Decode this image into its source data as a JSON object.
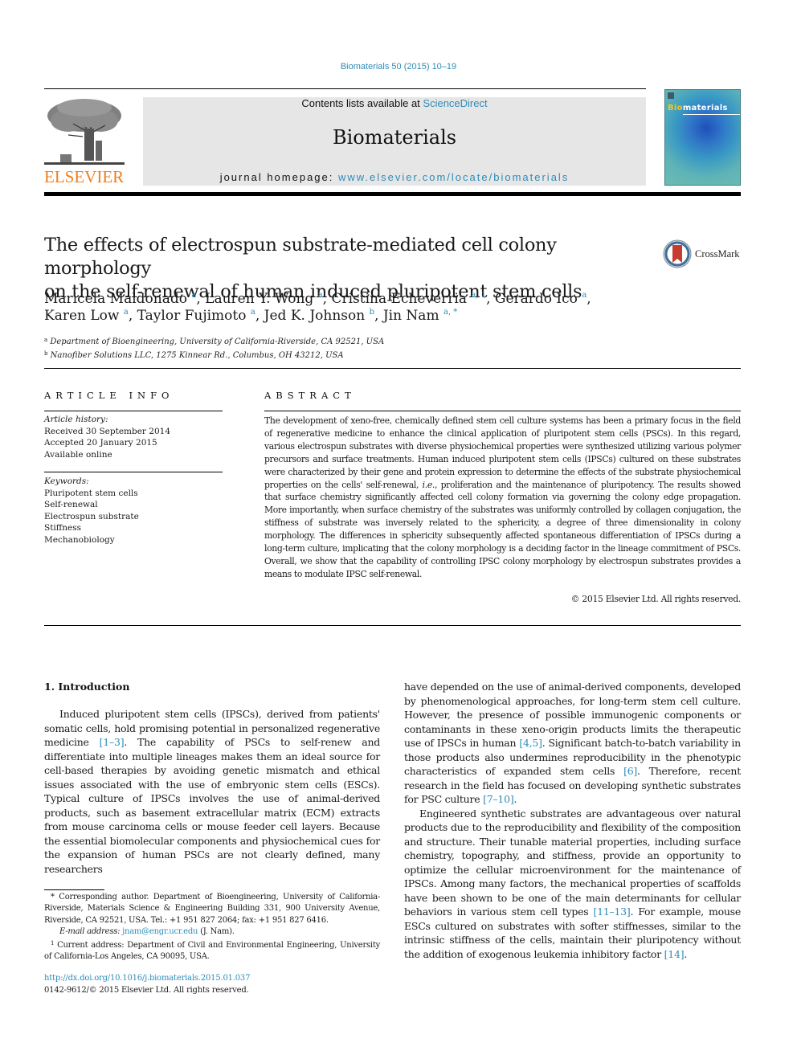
{
  "header": {
    "journal_ref": "Biomaterials 50 (2015) 10–19",
    "contents_prefix": "Contents lists available at ",
    "contents_link": "ScienceDirect",
    "journal_title": "Biomaterials",
    "homepage_prefix": "journal homepage: ",
    "homepage_link": "www.elsevier.com/locate/biomaterials",
    "publisher_logo_text": "ELSEVIER",
    "cover_title_highlight": "Bio",
    "cover_title_rest": "materials",
    "colors": {
      "link": "#2e8cb8",
      "publisher_orange": "#f07e1d",
      "masthead_bg": "#e6e6e6"
    }
  },
  "article": {
    "title_line1": "The effects of electrospun substrate-mediated cell colony morphology",
    "title_line2": "on the self-renewal of human induced pluripotent stem cells",
    "crossmark_label": "CrossMark",
    "authors": [
      {
        "name": "Maricela Maldonado",
        "sup": "a"
      },
      {
        "name": "Lauren Y. Wong",
        "sup": "a"
      },
      {
        "name": "Cristina Echeverria",
        "sup": "a, 1"
      },
      {
        "name": "Gerardo Ico",
        "sup": "a"
      },
      {
        "name": "Karen Low",
        "sup": "a"
      },
      {
        "name": "Taylor Fujimoto",
        "sup": "a"
      },
      {
        "name": "Jed K. Johnson",
        "sup": "b"
      },
      {
        "name": "Jin Nam",
        "sup": "a, *"
      }
    ],
    "affiliations": [
      {
        "key": "a",
        "text": "Department of Bioengineering, University of California-Riverside, CA 92521, USA"
      },
      {
        "key": "b",
        "text": "Nanofiber Solutions LLC, 1275 Kinnear Rd., Columbus, OH 43212, USA"
      }
    ]
  },
  "article_info": {
    "heading": "ARTICLE INFO",
    "history_label": "Article history:",
    "history": [
      "Received 30 September 2014",
      "Accepted 20 January 2015",
      "Available online"
    ],
    "keywords_label": "Keywords:",
    "keywords": [
      "Pluripotent stem cells",
      "Self-renewal",
      "Electrospun substrate",
      "Stiffness",
      "Mechanobiology"
    ]
  },
  "abstract": {
    "heading": "ABSTRACT",
    "text_part1": "The development of xeno-free, chemically defined stem cell culture systems has been a primary focus in the field of regenerative medicine to enhance the clinical application of pluripotent stem cells (PSCs). In this regard, various electrospun substrates with diverse physiochemical properties were synthesized utilizing various polymer precursors and surface treatments. Human induced pluripotent stem cells (IPSCs) cultured on these substrates were characterized by their gene and protein expression to determine the effects of the substrate physiochemical properties on the cells' self-renewal, ",
    "text_italic": "i.e.",
    "text_part2": ", proliferation and the maintenance of pluripotency. The results showed that surface chemistry significantly affected cell colony formation via governing the colony edge propagation. More importantly, when surface chemistry of the substrates was uniformly controlled by collagen conjugation, the stiffness of substrate was inversely related to the sphericity, a degree of three dimensionality in colony morphology. The differences in sphericity subsequently affected spontaneous differentiation of IPSCs during a long-term culture, implicating that the colony morphology is a deciding factor in the lineage commitment of PSCs. Overall, we show that the capability of controlling IPSC colony morphology by electrospun substrates provides a means to modulate IPSC self-renewal.",
    "copyright": "© 2015 Elsevier Ltd. All rights reserved."
  },
  "introduction": {
    "heading": "1.  Introduction",
    "p1_a": "Induced pluripotent stem cells (IPSCs), derived from patients' somatic cells, hold promising potential in personalized regenerative medicine ",
    "p1_ref1": "[1–3]",
    "p1_b": ". The capability of PSCs to self-renew and differentiate into multiple lineages makes them an ideal source for cell-based therapies by avoiding genetic mismatch and ethical issues associated with the use of embryonic stem cells (ESCs). Typical culture of IPSCs involves the use of animal-derived products, such as basement extracellular matrix (ECM) extracts from mouse carcinoma cells or mouse feeder cell layers. Because the essential biomolecular components and physiochemical cues for the expansion of human PSCs are not clearly defined, many researchers",
    "p2_a": "have depended on the use of animal-derived components, developed by phenomenological approaches, for long-term stem cell culture. However, the presence of possible immunogenic components or contaminants in these xeno-origin products limits the therapeutic use of IPSCs in human ",
    "p2_ref1": "[4,5]",
    "p2_b": ". Significant batch-to-batch variability in those products also undermines reproducibility in the phenotypic characteristics of expanded stem cells ",
    "p2_ref2": "[6]",
    "p2_c": ". Therefore, recent research in the field has focused on developing synthetic substrates for PSC culture ",
    "p2_ref3": "[7–10]",
    "p2_d": ".",
    "p3_a": "Engineered synthetic substrates are advantageous over natural products due to the reproducibility and flexibility of the composition and structure. Their tunable material properties, including surface chemistry, topography, and stiffness, provide an opportunity to optimize the cellular microenvironment for the maintenance of IPSCs. Among many factors, the mechanical properties of scaffolds have been shown to be one of the main determinants for cellular behaviors in various stem cell types ",
    "p3_ref1": "[11–13]",
    "p3_b": ". For example, mouse ESCs cultured on substrates with softer stiffnesses, similar to the intrinsic stiffness of the cells, maintain their pluripotency without the addition of exogenous leukemia inhibitory factor ",
    "p3_ref2": "[14]",
    "p3_c": "."
  },
  "footnotes": {
    "corresponding": "* Corresponding author. Department of Bioengineering, University of California-Riverside, Materials Science & Engineering Building 331, 900 University Avenue, Riverside, CA 92521, USA. Tel.: +1 951 827 2064; fax: +1 951 827 6416.",
    "email_label": "E-mail address: ",
    "email": "jnam@engr.ucr.edu",
    "email_suffix": " (J. Nam).",
    "fn1_mark": "1",
    "fn1_text": " Current address: Department of Civil and Environmental Engineering, University of California-Los Angeles, CA 90095, USA.",
    "doi": "http://dx.doi.org/10.1016/j.biomaterials.2015.01.037",
    "issn": "0142-9612/© 2015 Elsevier Ltd. All rights reserved."
  }
}
